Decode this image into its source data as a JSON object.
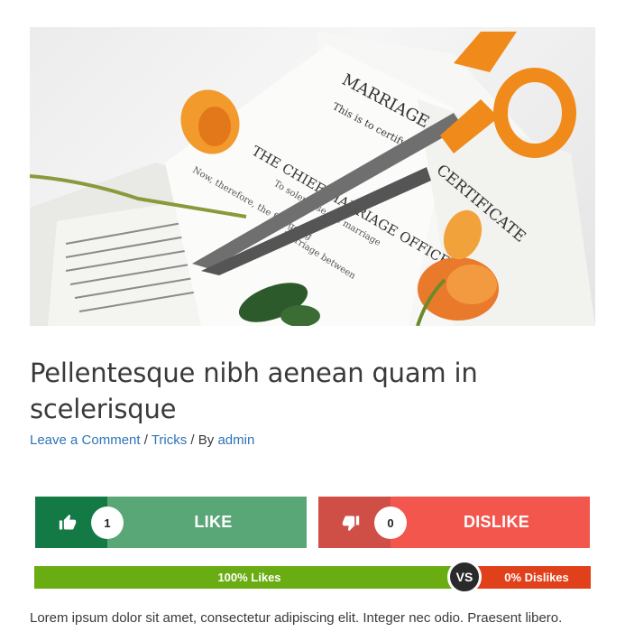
{
  "post": {
    "title": "Pellentesque nibh aenean quam in scelerisque",
    "meta": {
      "comment_link": "Leave a Comment",
      "separator1": " / ",
      "category": "Tricks",
      "separator2": " / By ",
      "author": "admin"
    },
    "excerpt": "Lorem ipsum dolor sit amet, consectetur adipiscing elit. Integer nec odio. Praesent libero.",
    "image_text": {
      "line1": "MARRIAGE",
      "line2": "This is to certify",
      "line3": "CERTIFICATE",
      "line4": "THE CHIEF MARRIAGE OFFICER"
    }
  },
  "vote": {
    "like_label": "LIKE",
    "like_count": "1",
    "dislike_label": "DISLIKE",
    "dislike_count": "0",
    "like_bar_text": "100% Likes",
    "dislike_bar_text": "0% Dislikes",
    "vs_label": "VS",
    "like_percent": 100,
    "dislike_percent": 0
  },
  "colors": {
    "like_dark": "#137a46",
    "like_light": "#59a676",
    "dislike_dark": "#cf4f47",
    "dislike_light": "#f2564c",
    "bar_like": "#6aad12",
    "bar_dislike": "#e0401a",
    "link": "#2f73b8"
  },
  "icons": {
    "like": "thumbs-up-icon",
    "dislike": "thumbs-down-icon"
  }
}
